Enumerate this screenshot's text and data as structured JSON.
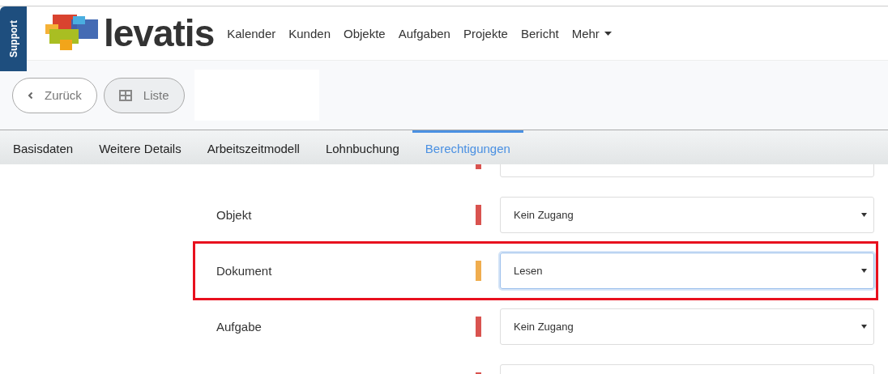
{
  "support_tab": "Support",
  "logo": {
    "wordmark": "levatis"
  },
  "nav": [
    {
      "label": "Kalender",
      "dropdown": false
    },
    {
      "label": "Kunden",
      "dropdown": false
    },
    {
      "label": "Objekte",
      "dropdown": false
    },
    {
      "label": "Aufgaben",
      "dropdown": false
    },
    {
      "label": "Projekte",
      "dropdown": false
    },
    {
      "label": "Bericht",
      "dropdown": false
    },
    {
      "label": "Mehr",
      "dropdown": true
    }
  ],
  "toolbar": {
    "back_button": "Zurück",
    "list_button": "Liste"
  },
  "tabs": [
    {
      "label": "Basisdaten",
      "selected": false
    },
    {
      "label": "Weitere Details",
      "selected": false
    },
    {
      "label": "Arbeitszeitmodell",
      "selected": false
    },
    {
      "label": "Lohnbuchung",
      "selected": false
    },
    {
      "label": "Berechtigungen",
      "selected": true
    }
  ],
  "permissions": [
    {
      "color": "#d9534f",
      "highlighted": false
    },
    {
      "label": "Objekt",
      "color": "#d9534f",
      "value": "Kein Zugang",
      "highlighted": false
    },
    {
      "label": "Dokument",
      "color": "#f0ad4e",
      "value": "Lesen",
      "highlighted": true
    },
    {
      "label": "Aufgabe",
      "color": "#d9534f",
      "value": "Kein Zugang",
      "highlighted": false
    },
    {
      "color": "#d9534f",
      "highlighted": false
    }
  ]
}
